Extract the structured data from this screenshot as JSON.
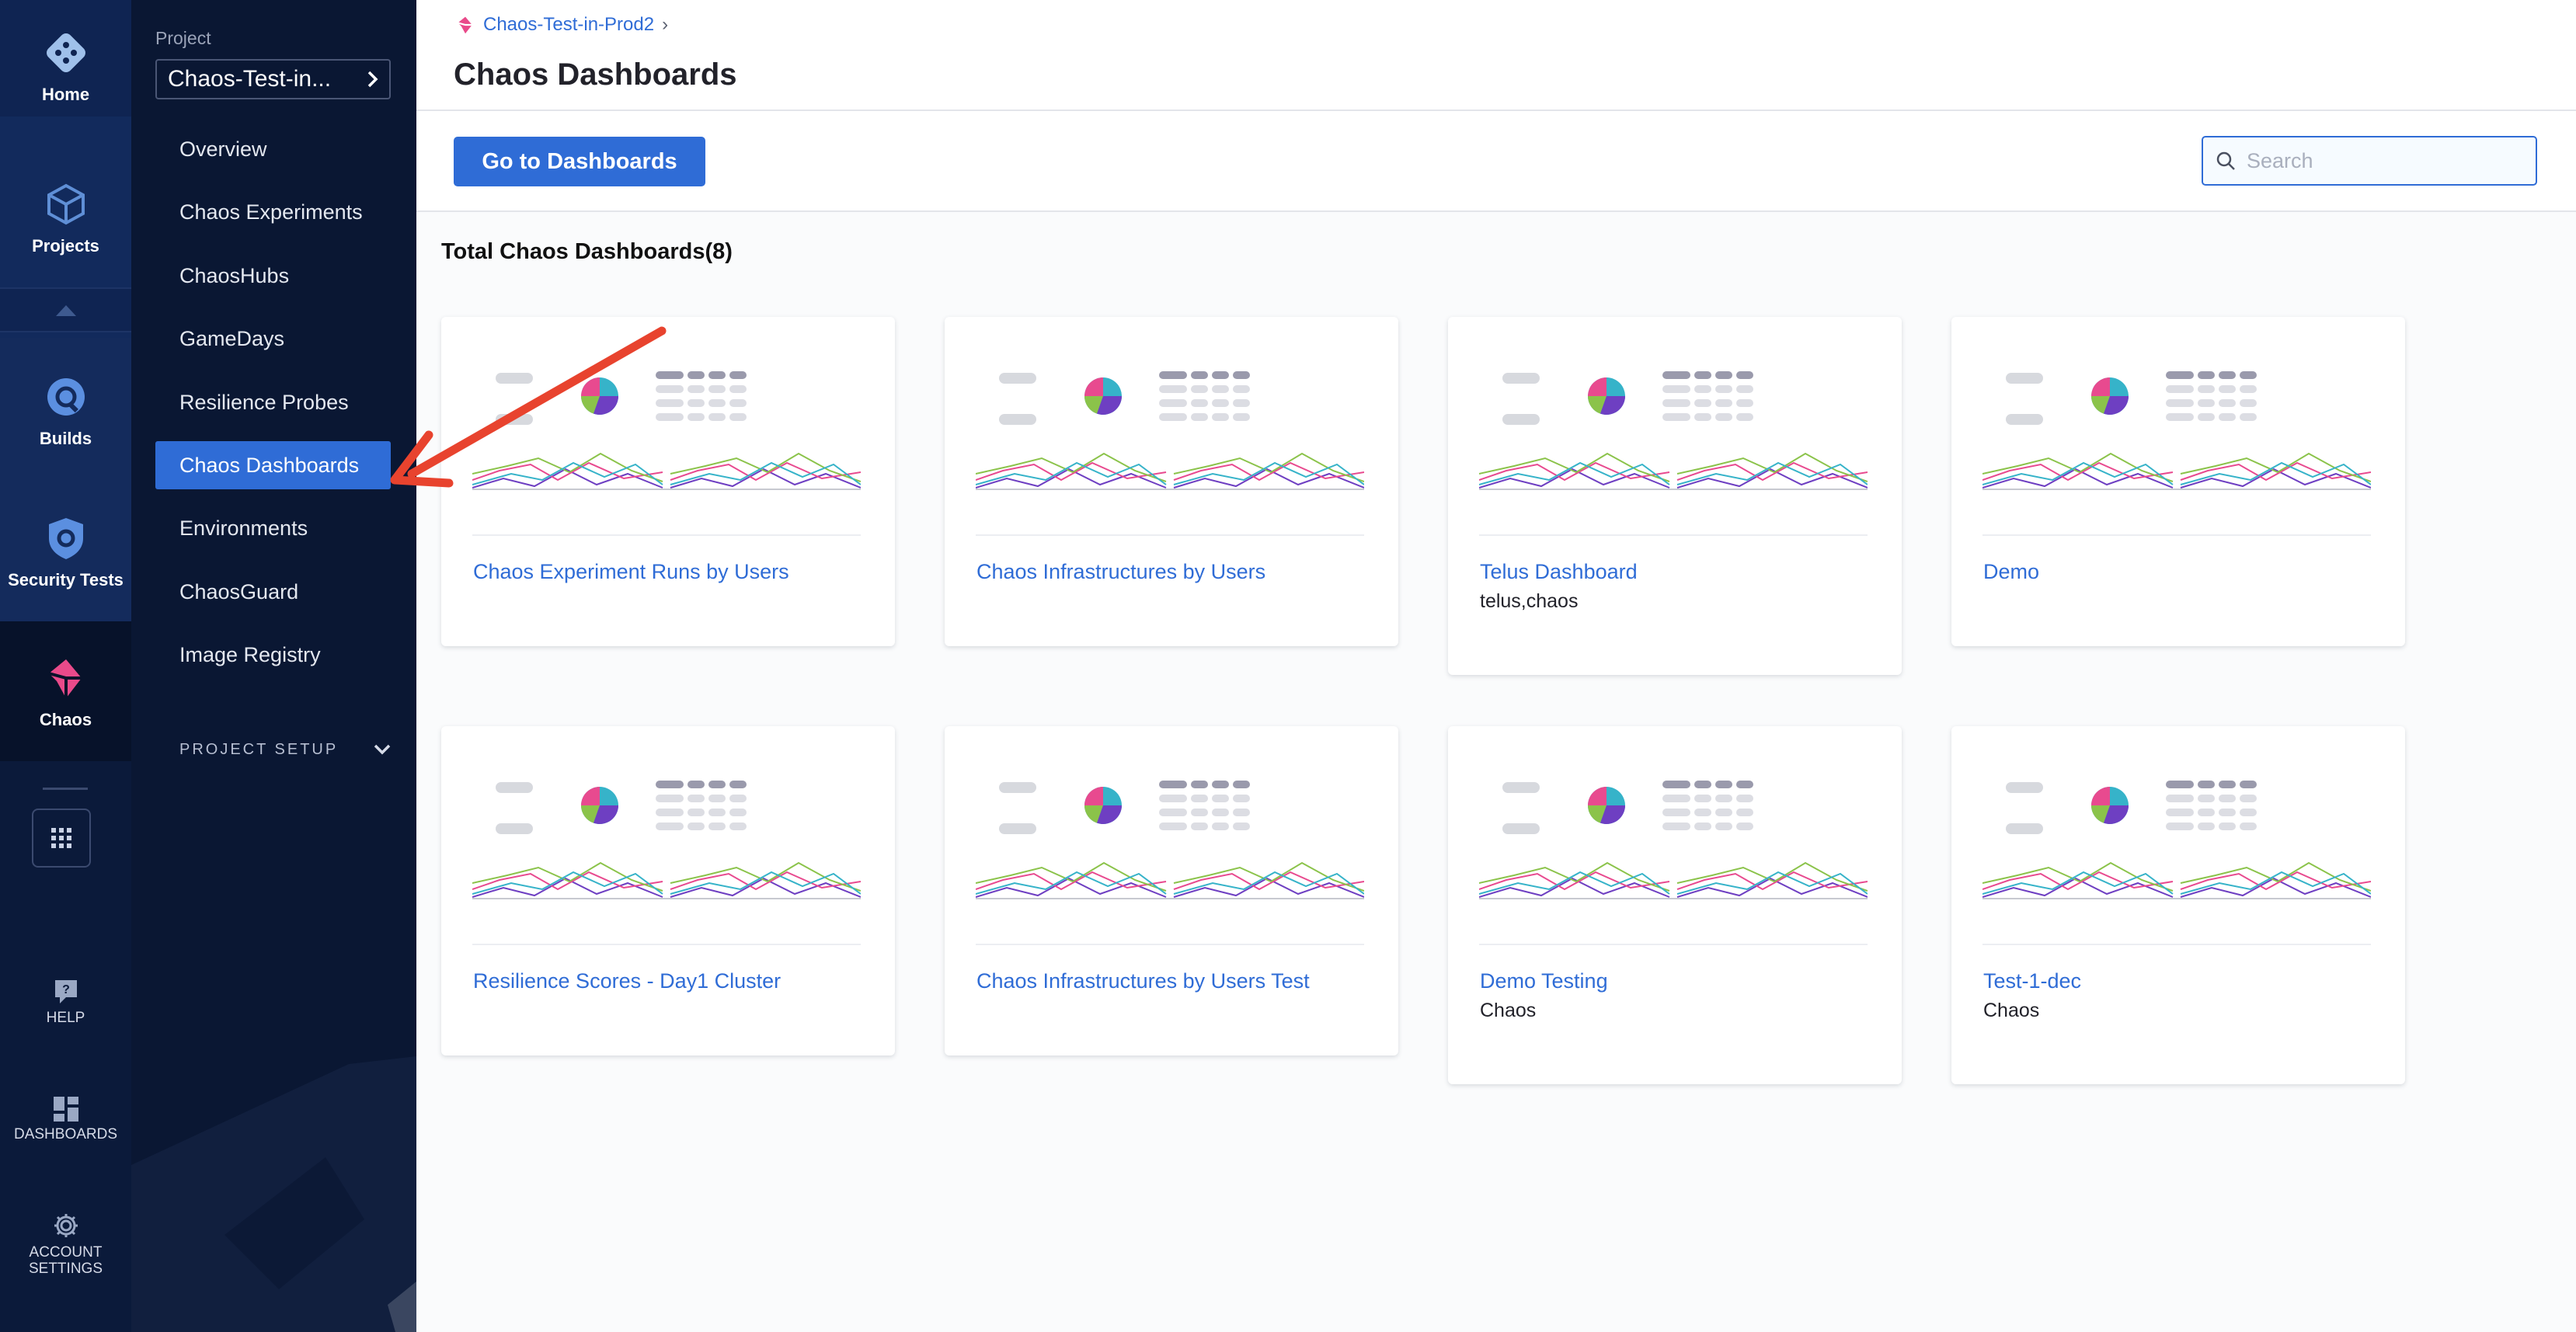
{
  "rail": {
    "home": "Home",
    "projects": "Projects",
    "builds": "Builds",
    "security": "Security Tests",
    "chaos": "Chaos",
    "help": "HELP",
    "dashboards": "DASHBOARDS",
    "account": "ACCOUNT SETTINGS"
  },
  "nav": {
    "project_label": "Project",
    "project_value": "Chaos-Test-in...",
    "items": [
      {
        "label": "Overview"
      },
      {
        "label": "Chaos Experiments"
      },
      {
        "label": "ChaosHubs"
      },
      {
        "label": "GameDays"
      },
      {
        "label": "Resilience Probes"
      },
      {
        "label": "Chaos Dashboards",
        "active": true
      },
      {
        "label": "Environments"
      },
      {
        "label": "ChaosGuard"
      },
      {
        "label": "Image Registry"
      }
    ],
    "project_setup": "PROJECT SETUP"
  },
  "header": {
    "breadcrumb": "Chaos-Test-in-Prod2",
    "title": "Chaos Dashboards"
  },
  "toolbar": {
    "go_button": "Go to Dashboards",
    "search_placeholder": "Search"
  },
  "main": {
    "total": "Total Chaos Dashboards(8)",
    "cards": [
      {
        "title": "Chaos Experiment Runs by Users",
        "desc": ""
      },
      {
        "title": "Chaos Infrastructures by Users",
        "desc": ""
      },
      {
        "title": "Telus Dashboard",
        "desc": "telus,chaos"
      },
      {
        "title": "Demo",
        "desc": ""
      },
      {
        "title": "Resilience Scores - Day1 Cluster",
        "desc": ""
      },
      {
        "title": "Chaos Infrastructures by Users Test",
        "desc": ""
      },
      {
        "title": "Demo Testing",
        "desc": "Chaos"
      },
      {
        "title": "Test-1-dec",
        "desc": "Chaos"
      }
    ]
  },
  "colors": {
    "accent": "#2f6cd6",
    "rail_bg": "#0b1a3a",
    "nav_bg": "#0a1733",
    "annotation": "#e8432e"
  },
  "icons": [
    "home-icon",
    "projects-icon",
    "builds-icon",
    "security-icon",
    "chaos-icon",
    "apps-grid-icon",
    "help-icon",
    "dashboards-icon",
    "gear-icon",
    "search-icon",
    "chevron-right-icon",
    "chevron-down-icon"
  ]
}
